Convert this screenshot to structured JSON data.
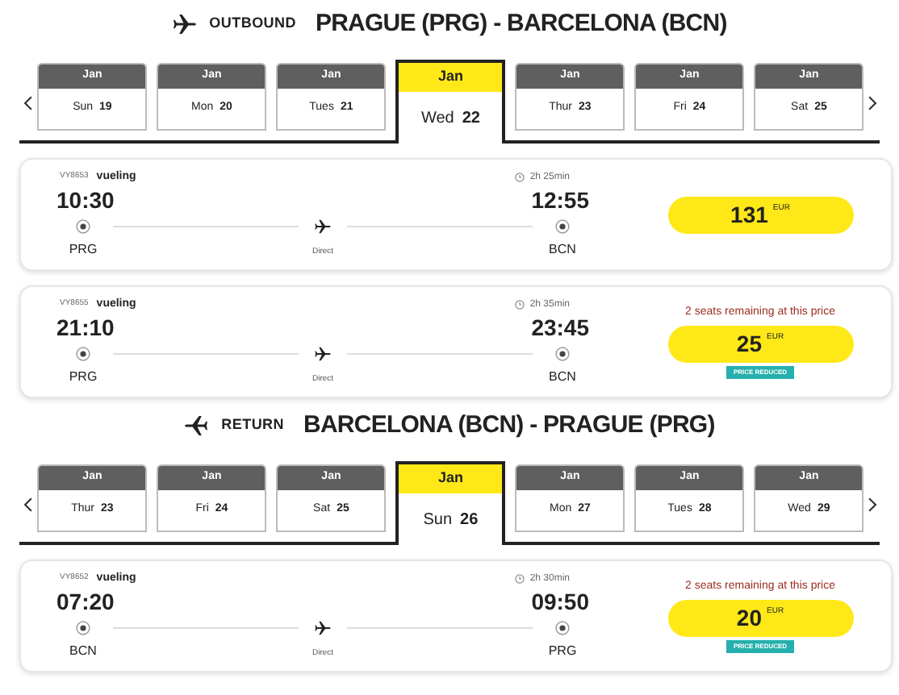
{
  "sections": [
    {
      "kind": "outbound",
      "label": "OUTBOUND",
      "route": "PRAGUE (PRG) - BARCELONA (BCN)",
      "dates": [
        {
          "month": "Jan",
          "day_name": "Sun",
          "day": "19",
          "selected": false
        },
        {
          "month": "Jan",
          "day_name": "Mon",
          "day": "20",
          "selected": false
        },
        {
          "month": "Jan",
          "day_name": "Tues",
          "day": "21",
          "selected": false
        },
        {
          "month": "Jan",
          "day_name": "Wed",
          "day": "22",
          "selected": true
        },
        {
          "month": "Jan",
          "day_name": "Thur",
          "day": "23",
          "selected": false
        },
        {
          "month": "Jan",
          "day_name": "Fri",
          "day": "24",
          "selected": false
        },
        {
          "month": "Jan",
          "day_name": "Sat",
          "day": "25",
          "selected": false
        }
      ],
      "flights": [
        {
          "flight_number": "VY8653",
          "airline": "vueling",
          "duration": "2h 25min",
          "depart_time": "10:30",
          "arrive_time": "12:55",
          "origin": "PRG",
          "destination": "BCN",
          "stops": "Direct",
          "price": "131",
          "currency": "EUR"
        },
        {
          "flight_number": "VY8655",
          "airline": "vueling",
          "duration": "2h 35min",
          "depart_time": "21:10",
          "arrive_time": "23:45",
          "origin": "PRG",
          "destination": "BCN",
          "stops": "Direct",
          "seats_notice": "2 seats remaining at this price",
          "price": "25",
          "currency": "EUR",
          "badge": "PRICE REDUCED"
        }
      ]
    },
    {
      "kind": "return",
      "label": "RETURN",
      "route": "BARCELONA (BCN) - PRAGUE (PRG)",
      "dates": [
        {
          "month": "Jan",
          "day_name": "Thur",
          "day": "23",
          "selected": false
        },
        {
          "month": "Jan",
          "day_name": "Fri",
          "day": "24",
          "selected": false
        },
        {
          "month": "Jan",
          "day_name": "Sat",
          "day": "25",
          "selected": false
        },
        {
          "month": "Jan",
          "day_name": "Sun",
          "day": "26",
          "selected": true
        },
        {
          "month": "Jan",
          "day_name": "Mon",
          "day": "27",
          "selected": false
        },
        {
          "month": "Jan",
          "day_name": "Tues",
          "day": "28",
          "selected": false
        },
        {
          "month": "Jan",
          "day_name": "Wed",
          "day": "29",
          "selected": false
        }
      ],
      "flights": [
        {
          "flight_number": "VY8652",
          "airline": "vueling",
          "duration": "2h 30min",
          "depart_time": "07:20",
          "arrive_time": "09:50",
          "origin": "BCN",
          "destination": "PRG",
          "stops": "Direct",
          "seats_notice": "2 seats remaining at this price",
          "price": "20",
          "currency": "EUR",
          "badge": "PRICE REDUCED"
        }
      ]
    }
  ]
}
